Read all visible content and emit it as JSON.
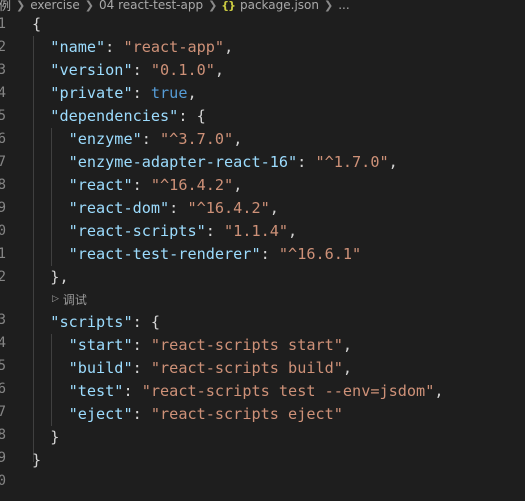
{
  "breadcrumb": {
    "items": [
      "例",
      "exercise",
      "04 react-test-app",
      "package.json"
    ],
    "json_icon": "{}",
    "trailing": "..."
  },
  "editor": {
    "line_numbers": [
      "1",
      "2",
      "3",
      "4",
      "5",
      "6",
      "7",
      "8",
      "9",
      "10",
      "11",
      "12",
      "13",
      "14",
      "15",
      "16",
      "17",
      "18",
      "19",
      "20"
    ],
    "codelens_label": "调试",
    "codelens_icon": "play-triangle-icon",
    "code": {
      "open_brace": "{",
      "name_key": "\"name\"",
      "name_val": "\"react-app\"",
      "version_key": "\"version\"",
      "version_val": "\"0.1.0\"",
      "private_key": "\"private\"",
      "private_val": "true",
      "deps_key": "\"dependencies\"",
      "deps": [
        {
          "key": "\"enzyme\"",
          "val": "\"^3.7.0\""
        },
        {
          "key": "\"enzyme-adapter-react-16\"",
          "val": "\"^1.7.0\""
        },
        {
          "key": "\"react\"",
          "val": "\"^16.4.2\""
        },
        {
          "key": "\"react-dom\"",
          "val": "\"^16.4.2\""
        },
        {
          "key": "\"react-scripts\"",
          "val": "\"1.1.4\""
        },
        {
          "key": "\"react-test-renderer\"",
          "val": "\"^16.6.1\""
        }
      ],
      "deps_close": "},",
      "scripts_key": "\"scripts\"",
      "scripts": [
        {
          "key": "\"start\"",
          "val": "\"react-scripts start\""
        },
        {
          "key": "\"build\"",
          "val": "\"react-scripts build\""
        },
        {
          "key": "\"test\"",
          "val": "\"react-scripts test --env=jsdom\""
        },
        {
          "key": "\"eject\"",
          "val": "\"react-scripts eject\""
        }
      ],
      "scripts_close": "}",
      "close_brace": "}"
    }
  },
  "colors": {
    "background": "#1e1e1e",
    "key": "#9cdcfe",
    "string": "#ce9178",
    "boolean": "#569cd6",
    "punctuation": "#d4d4d4",
    "line_number": "#858585"
  }
}
